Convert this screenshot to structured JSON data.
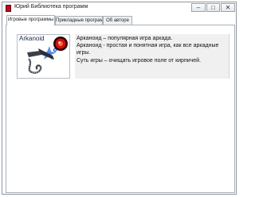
{
  "window": {
    "title": "Юрий Библиотека программ",
    "controls": {
      "minimize": "–",
      "maximize": "□",
      "close": "✕"
    }
  },
  "tabs": [
    {
      "label": "Игровые программы",
      "active": true
    },
    {
      "label": "Прикладные программы",
      "active": false
    },
    {
      "label": "Об авторе",
      "active": false
    }
  ],
  "program": {
    "thumbnail_label": "Arkanoid",
    "description": [
      "Арканоид – популярная игра аркада.",
      "Арканоид - простая и понятная игра, как все аркадные",
      "игры.",
      "Суть игры – очищать игровое поле от кирпичей."
    ]
  },
  "colors": {
    "app_icon": "#b3121c",
    "description_bg": "#f0f0f0",
    "thumbnail_title": "#1b2a4a"
  }
}
